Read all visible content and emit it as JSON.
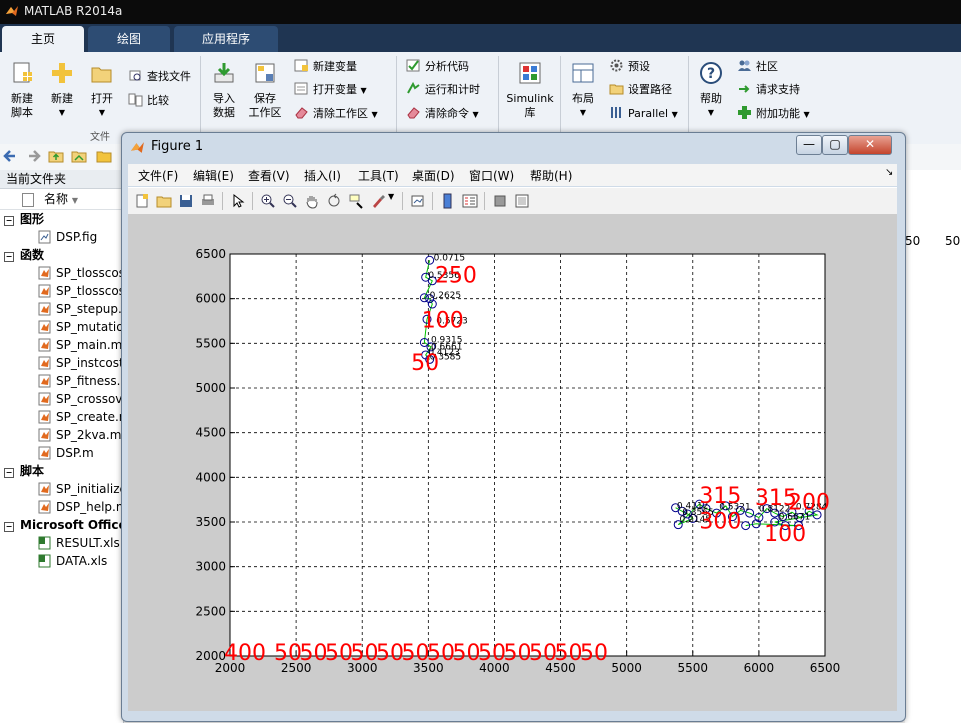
{
  "app": {
    "title": "MATLAB R2014a"
  },
  "tabs": [
    "主页",
    "绘图",
    "应用程序"
  ],
  "ribbon": {
    "file": {
      "new_script": "新建\n脚本",
      "new": "新建",
      "open": "打开",
      "find_files": "查找文件",
      "compare": "比较",
      "group": "文件"
    },
    "variable": {
      "import": "导入\n数据",
      "save_ws": "保存\n工作区",
      "new_var": "新建变量",
      "open_var": "打开变量",
      "clear_ws": "清除工作区"
    },
    "code": {
      "analyze": "分析代码",
      "run_time": "运行和计时",
      "clear_cmd": "清除命令"
    },
    "simulink": {
      "label": "Simulink\n库"
    },
    "env": {
      "layout": "布局",
      "prefs": "预设",
      "set_path": "设置路径",
      "parallel": "Parallel"
    },
    "resources": {
      "help": "帮助",
      "community": "社区",
      "support": "请求支持",
      "addons": "附加功能"
    }
  },
  "left_panel": {
    "title": "当前文件夹",
    "col_name": "名称",
    "groups": [
      {
        "label": "图形",
        "files": [
          "DSP.fig"
        ]
      },
      {
        "label": "函数",
        "files": [
          "SP_tlosscos",
          "SP_tlosscos",
          "SP_stepup.m",
          "SP_mutatio",
          "SP_main.m",
          "SP_instcost",
          "SP_fitness.m",
          "SP_crossov",
          "SP_create.m",
          "SP_2kva.m",
          "DSP.m"
        ]
      },
      {
        "label": "脚本",
        "files": [
          "SP_initialize",
          "DSP_help.m"
        ]
      },
      {
        "label": "Microsoft Office",
        "files": [
          "RESULT.xls",
          "DATA.xls"
        ]
      }
    ]
  },
  "right_bg_numbers": [
    "50",
    "50"
  ],
  "figure": {
    "title": "Figure 1",
    "menu": [
      "文件(F)",
      "编辑(E)",
      "查看(V)",
      "插入(I)",
      "工具(T)",
      "桌面(D)",
      "窗口(W)",
      "帮助(H)"
    ]
  },
  "colors": {
    "accent_red": "#ff0000",
    "marker_blue": "#00008b",
    "line_green": "#00c000",
    "ribbon_bg": "#eef2f7",
    "tabbar_bg": "#1f3552"
  },
  "chart_data": {
    "type": "scatter",
    "xlim": [
      2000,
      6500
    ],
    "ylim": [
      2000,
      6500
    ],
    "xticks": [
      2000,
      2500,
      3000,
      3500,
      4000,
      4500,
      5000,
      5500,
      6000,
      6500
    ],
    "yticks": [
      2000,
      2500,
      3000,
      3500,
      4000,
      4500,
      5000,
      5500,
      6000,
      6500
    ],
    "grid": true,
    "cluster_a": {
      "markers": [
        [
          3510,
          6430
        ],
        [
          3480,
          6240
        ],
        [
          3530,
          6200
        ],
        [
          3470,
          6010
        ],
        [
          3510,
          6000
        ],
        [
          3530,
          5940
        ],
        [
          3490,
          5770
        ],
        [
          3470,
          5510
        ],
        [
          3520,
          5460
        ],
        [
          3480,
          5370
        ],
        [
          3510,
          5320
        ]
      ],
      "small_labels": [
        {
          "x": 3540,
          "y": 6430,
          "text": "0.0715"
        },
        {
          "x": 3500,
          "y": 6230,
          "text": "0.5356"
        },
        {
          "x": 3510,
          "y": 6010,
          "text": "0.2625"
        },
        {
          "x": 3560,
          "y": 5720,
          "text": "0.5723"
        },
        {
          "x": 3520,
          "y": 5510,
          "text": "0.9315"
        },
        {
          "x": 3520,
          "y": 5430,
          "text": "0.6661"
        },
        {
          "x": 3500,
          "y": 5370,
          "text": "0.4123"
        },
        {
          "x": 3510,
          "y": 5320,
          "text": "0.3585"
        }
      ],
      "big_labels": [
        {
          "x": 3550,
          "y": 6180,
          "text": "250"
        },
        {
          "x": 3450,
          "y": 5680,
          "text": "100"
        },
        {
          "x": 3370,
          "y": 5200,
          "text": "50"
        }
      ]
    },
    "cluster_b": {
      "markers": [
        [
          5370,
          3660
        ],
        [
          5420,
          3620
        ],
        [
          5460,
          3590
        ],
        [
          5500,
          3540
        ],
        [
          5390,
          3470
        ],
        [
          5550,
          3700
        ],
        [
          5600,
          3650
        ],
        [
          5680,
          3600
        ],
        [
          5750,
          3680
        ],
        [
          5800,
          3560
        ],
        [
          5860,
          3630
        ],
        [
          5930,
          3600
        ],
        [
          6000,
          3550
        ],
        [
          6060,
          3650
        ],
        [
          6120,
          3600
        ],
        [
          6180,
          3560
        ],
        [
          6250,
          3610
        ],
        [
          6310,
          3550
        ],
        [
          6380,
          3620
        ],
        [
          6440,
          3580
        ],
        [
          6120,
          3500
        ],
        [
          6200,
          3460
        ],
        [
          6300,
          3460
        ],
        [
          5980,
          3480
        ],
        [
          5900,
          3460
        ]
      ],
      "small_labels": [
        {
          "x": 5380,
          "y": 3650,
          "text": "0.4112"
        },
        {
          "x": 5420,
          "y": 3580,
          "text": "0.3565"
        },
        {
          "x": 5400,
          "y": 3500,
          "text": "0.2145"
        },
        {
          "x": 5700,
          "y": 3640,
          "text": "0.5321"
        },
        {
          "x": 6000,
          "y": 3620,
          "text": "0.8122"
        },
        {
          "x": 6150,
          "y": 3530,
          "text": "0.6671"
        },
        {
          "x": 6280,
          "y": 3640,
          "text": "0.7284"
        }
      ],
      "big_labels": [
        {
          "x": 5550,
          "y": 3710,
          "text": "315"
        },
        {
          "x": 5970,
          "y": 3690,
          "text": "315"
        },
        {
          "x": 6220,
          "y": 3640,
          "text": "200"
        },
        {
          "x": 5550,
          "y": 3430,
          "text": "300"
        },
        {
          "x": 6040,
          "y": 3290,
          "text": "100"
        }
      ]
    },
    "bottom_labels": [
      "400",
      "50",
      "50",
      "50",
      "50",
      "50",
      "50",
      "50",
      "50",
      "50",
      "50",
      "50",
      "50",
      "50"
    ]
  }
}
